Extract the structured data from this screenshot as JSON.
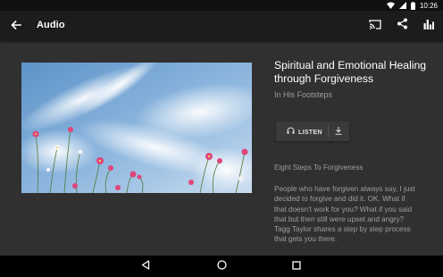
{
  "status_bar": {
    "time": "10:26",
    "icons": [
      "wifi-icon",
      "cell-signal-icon",
      "battery-icon"
    ]
  },
  "app_bar": {
    "title": "Audio",
    "actions": [
      "cast-icon",
      "share-icon",
      "equalizer-icon"
    ]
  },
  "episode": {
    "title": "Spiritual and Emotional Healing through Forgiveness",
    "series": "In His Footsteps",
    "listen_label": "LISTEN",
    "section_heading": "Eight Steps To Forgiveness",
    "description_lines": [
      "People who have forgiven always say, I just",
      "decided to forgive and did it.  OK.  What if",
      "that doesn't work for you?  What if you said",
      "that but then still were upset and angry?",
      "Tagg Taylor shares a step by step process",
      "that gets you there."
    ]
  },
  "colors": {
    "background": "#303030",
    "app_bar": "#1c1c1c",
    "status_bar": "#111111",
    "text_primary": "#ffffff",
    "text_secondary": "#9e9e9e"
  },
  "nav_bar": {
    "buttons": [
      "back-triangle-icon",
      "home-circle-icon",
      "recents-square-icon"
    ]
  }
}
